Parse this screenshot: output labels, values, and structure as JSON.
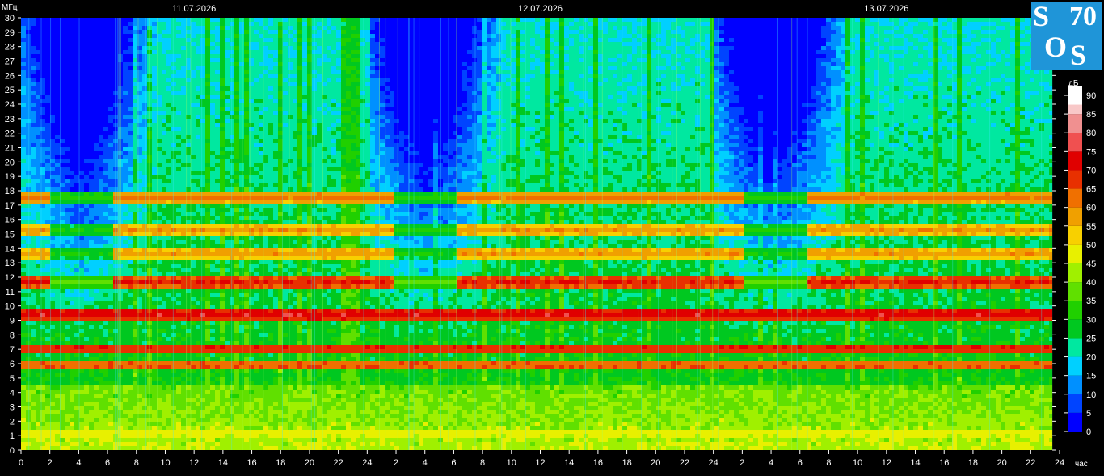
{
  "chart_data": {
    "type": "heatmap",
    "title": "",
    "ylabel": "МГц",
    "xlabel": "час",
    "ylim": [
      0,
      30
    ],
    "y_ticks": [
      0,
      1,
      2,
      3,
      4,
      5,
      6,
      7,
      8,
      9,
      10,
      11,
      12,
      13,
      14,
      15,
      16,
      17,
      18,
      19,
      20,
      21,
      22,
      23,
      24,
      25,
      26,
      27,
      28,
      29,
      30
    ],
    "x_ticks": [
      "0",
      "2",
      "4",
      "6",
      "8",
      "10",
      "12",
      "14",
      "16",
      "18",
      "20",
      "22",
      "24",
      "2",
      "4",
      "6",
      "8",
      "10",
      "12",
      "14",
      "16",
      "18",
      "20",
      "22",
      "24",
      "2",
      "4",
      "6",
      "8",
      "10",
      "12",
      "14",
      "16",
      "18",
      "20",
      "22",
      "24"
    ],
    "x_range_hours": [
      0,
      71.5
    ],
    "dates": [
      {
        "label": "11.07.2026",
        "hour": 12
      },
      {
        "label": "12.07.2026",
        "hour": 36
      },
      {
        "label": "13.07.2026",
        "hour": 60
      }
    ],
    "colorbar": {
      "unit": "дБ",
      "ticks": [
        0,
        5,
        10,
        15,
        20,
        25,
        30,
        35,
        40,
        45,
        50,
        55,
        60,
        65,
        70,
        75,
        80,
        85,
        90
      ],
      "colors": [
        "#0000ff",
        "#0044ff",
        "#0090ff",
        "#00d0ff",
        "#00e8a0",
        "#00c820",
        "#20d000",
        "#60e000",
        "#a0f000",
        "#e8f000",
        "#f8d000",
        "#f0a000",
        "#f07000",
        "#e83000",
        "#e00000",
        "#f05050",
        "#f09090",
        "#f8c8c8",
        "#ffffff"
      ]
    },
    "bands": [
      {
        "mhz": 1.3,
        "db": 45
      },
      {
        "mhz": 6.0,
        "db": 62
      },
      {
        "mhz": 7.2,
        "db": 66
      },
      {
        "mhz": 9.6,
        "db": 70
      },
      {
        "mhz": 11.8,
        "db": 66
      },
      {
        "mhz": 13.8,
        "db": 55
      },
      {
        "mhz": 15.4,
        "db": 55
      },
      {
        "mhz": 17.7,
        "db": 58
      }
    ]
  },
  "logo": {
    "letters": [
      "S",
      "7",
      "0",
      "O",
      "S"
    ]
  }
}
